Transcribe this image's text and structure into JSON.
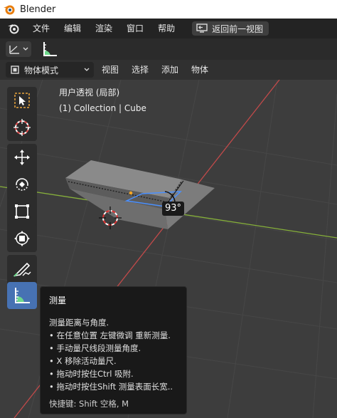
{
  "window": {
    "title": "Blender"
  },
  "menubar": {
    "items": [
      "文件",
      "编辑",
      "渲染",
      "窗口",
      "帮助"
    ],
    "back_button": "返回前一视图"
  },
  "viewport_header": {
    "mode": "物体模式",
    "menus": [
      "视图",
      "选择",
      "添加",
      "物体"
    ]
  },
  "viewport": {
    "view_name": "用户透视 (局部)",
    "collection_info": "(1) Collection | Cube",
    "angle_label": "93°"
  },
  "toolbar": {
    "tools": [
      "select-box",
      "cursor",
      "move",
      "rotate",
      "scale",
      "transform",
      "annotate",
      "measure"
    ],
    "active_tool": "measure"
  },
  "tooltip": {
    "title": "测量",
    "description": "测量距离与角度.",
    "bullets": [
      "• 在任意位置 左键微调 重新测量.",
      "• 手动量尺线段测量角度.",
      "• X 移除活动量尺.",
      "• 拖动时按住Ctrl 吸附.",
      "• 拖动时按住Shift 测量表面长宽.."
    ],
    "shortcut": "快捷键: Shift 空格, M"
  },
  "colors": {
    "accent": "#4772b3",
    "x_axis": "#c24a4a",
    "y_axis": "#86b03a",
    "measure_green": "#6ed98c"
  }
}
